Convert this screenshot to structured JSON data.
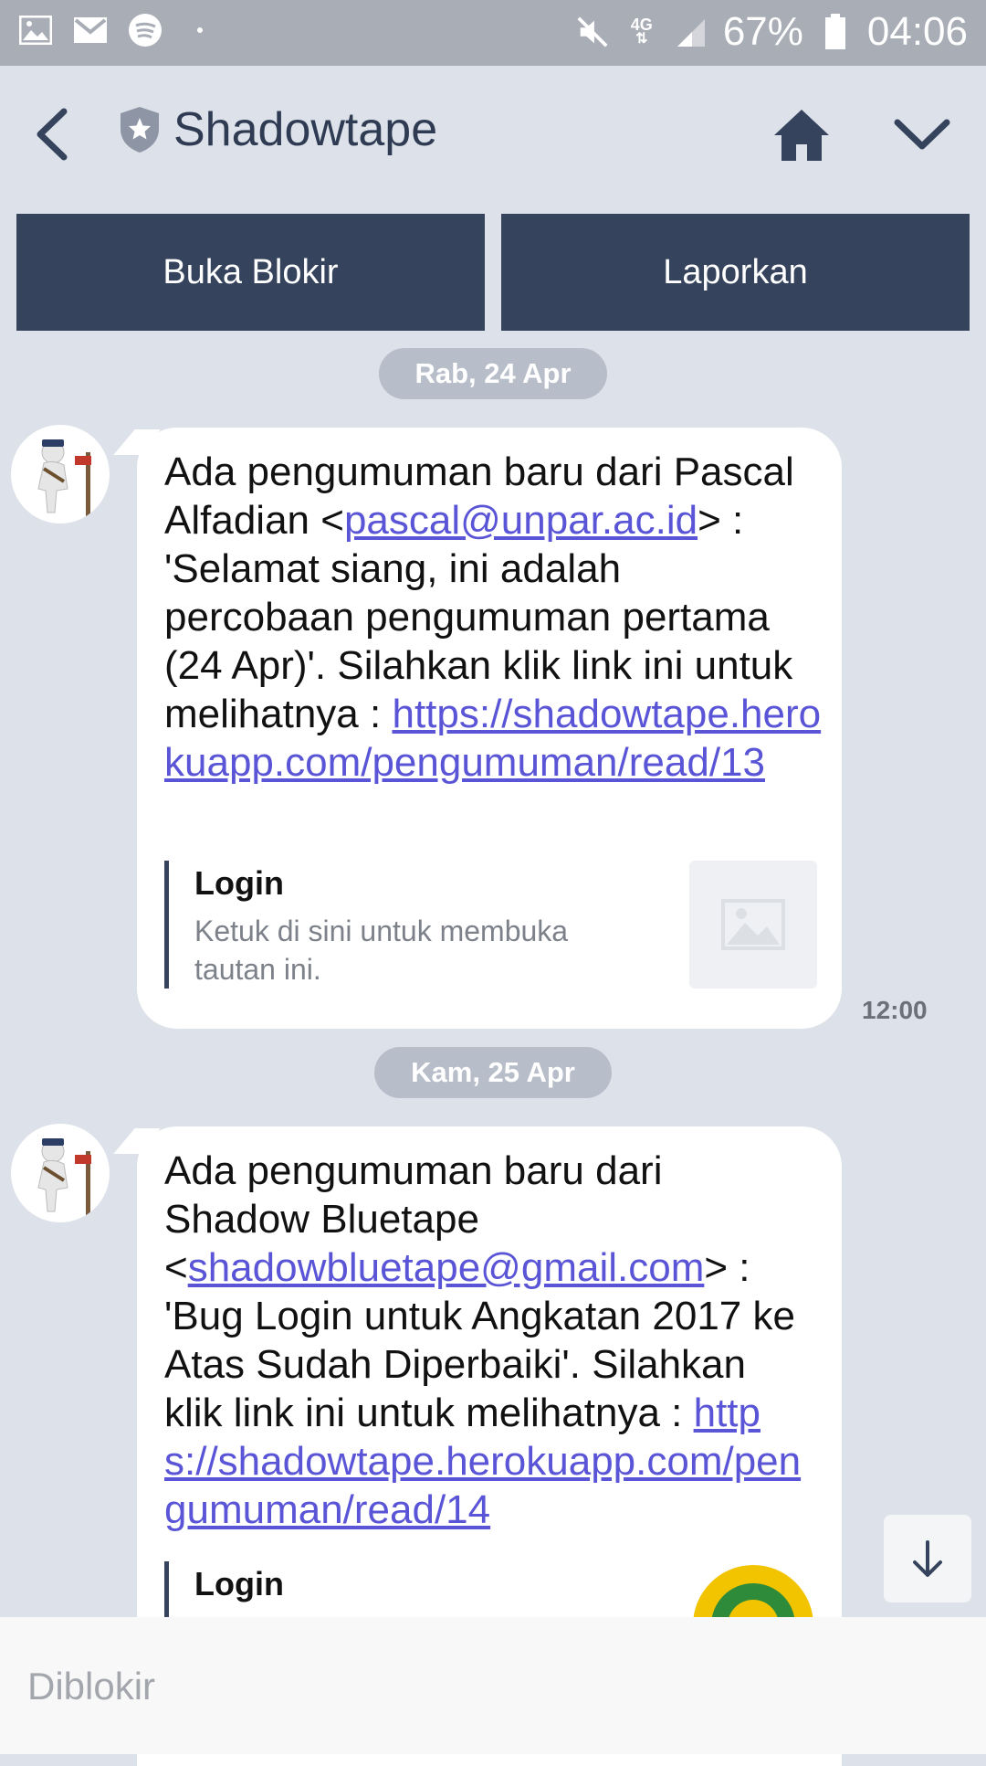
{
  "status_bar": {
    "battery": "67%",
    "time": "04:06",
    "network": "4G",
    "icons": [
      "gallery-icon",
      "gmail-icon",
      "spotify-icon",
      "dot-icon",
      "mute-icon",
      "network-icon",
      "signal-icon",
      "battery-icon"
    ]
  },
  "header": {
    "title": "Shadowtape",
    "icons": [
      "back-icon",
      "shield-star-icon",
      "home-icon",
      "chevron-down-icon"
    ]
  },
  "actions": {
    "unblock_label": "Buka Blokir",
    "report_label": "Laporkan"
  },
  "messages": [
    {
      "date": "Rab, 24 Apr",
      "line_prefix": "Ada pengumuman baru dari Pascal Alfadian <",
      "email": "pascal@unpar.ac.id",
      "middle": "> : 'Selamat siang, ini adalah percobaan pengumuman pertama (24 Apr)'. Silahkan klik link ini untuk melihatnya : ",
      "link": "https://shadowtape.herokuapp.com/pengumuman/read/13",
      "preview_title": "Login",
      "preview_desc": "Ketuk di sini untuk membuka tautan ini.",
      "time": "12:00"
    },
    {
      "date": "Kam, 25 Apr",
      "line_prefix": "Ada pengumuman baru dari Shadow Bluetape <",
      "email": "shadowbluetape@gmail.com",
      "middle": "> : 'Bug Login untuk Angkatan 2017 ke Atas Sudah Diperbaiki'. Silahkan klik link ini untuk melihatnya : ",
      "link": "https://shadowtape.herokuapp.com/pengumuman/read/14",
      "preview_title": "Login"
    }
  ],
  "footer": {
    "blocked_text": "Diblokir"
  },
  "colors": {
    "background": "#dde2ea",
    "button": "#36435c",
    "link": "#5a55d6",
    "date_pill": "#b8bec9"
  }
}
